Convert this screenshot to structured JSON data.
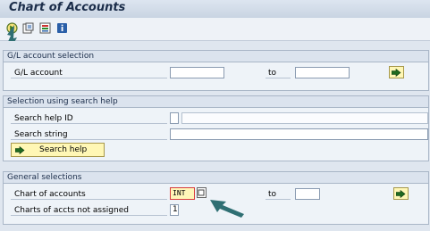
{
  "window": {
    "title": "Chart of Accounts"
  },
  "toolbar": {
    "icons": [
      "execute-icon",
      "save-variant-icon",
      "selection-options-icon",
      "info-icon"
    ]
  },
  "gl_selection": {
    "heading": "G/L account selection",
    "gl_account_label": "G/L account",
    "gl_account_from": "",
    "to_label": "to",
    "gl_account_to": ""
  },
  "search_help": {
    "heading": "Selection using search help",
    "id_label": "Search help ID",
    "id_value": "",
    "string_label": "Search string",
    "string_value": "",
    "button_label": "Search help"
  },
  "general": {
    "heading": "General selections",
    "coa_label": "Chart of accounts",
    "coa_value": "INT",
    "to_label": "to",
    "coa_to": "",
    "not_assigned_label": "Charts of accts not assigned",
    "not_assigned_value": "1"
  },
  "colors": {
    "accent_callout": "#2f6f73",
    "highlight_border": "#d83c3c",
    "button_fill": "#fff7b5"
  }
}
